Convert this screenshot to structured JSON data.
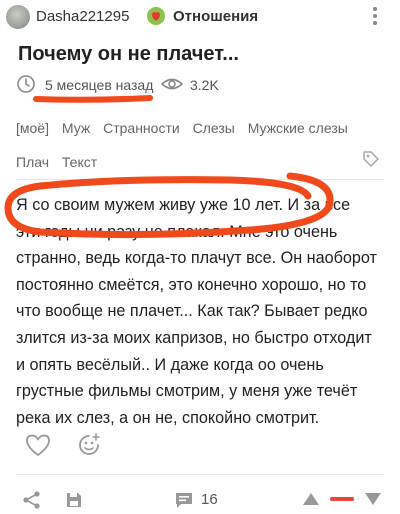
{
  "header": {
    "author": "Dasha221295",
    "category": "Отношения"
  },
  "post": {
    "title": "Почему он не плачет...",
    "time": "5 месяцев назад",
    "views": "3.2K",
    "tags_row1": [
      "[моё]",
      "Муж",
      "Странности",
      "Слезы",
      "Мужские слезы"
    ],
    "tags_row2": [
      "Плач",
      "Текст"
    ],
    "body_lines": [
      "Я со своим мужем живу уже 10 лет. И за все",
      "эти годы ни разу не плакал. Мне это очень",
      "странно, ведь когда-то плачут все. Он наоборот",
      "постоянно смеётся, это конечно хорошо, но то",
      "что вообще не плачет... Как так? Бывает редко",
      "злится из-за моих капризов, но быстро отходит",
      "и опять весёлый.. И даже когда оо очень",
      "грустные фильмы смотрим, у меня уже течёт",
      "река их слез, а он не, спокойно смотрит."
    ]
  },
  "footer": {
    "comments": "16"
  },
  "colors": {
    "annotation": "#f04a1c",
    "vote_bar": "#e8453c"
  },
  "icons": [
    "clock-icon",
    "eye-icon",
    "tag-icon",
    "heart-icon",
    "reaction-icon",
    "share-icon",
    "save-icon",
    "comment-icon",
    "arrow-up-icon",
    "arrow-down-icon",
    "more-icon"
  ]
}
